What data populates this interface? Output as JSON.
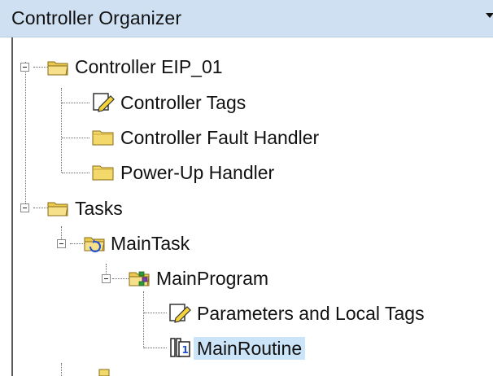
{
  "panel": {
    "title": "Controller Organizer"
  },
  "tree": {
    "controller": {
      "label": "Controller EIP_01",
      "icon": "folder-open-icon"
    },
    "controller_tags": {
      "label": "Controller Tags",
      "icon": "tags-pencil-icon"
    },
    "fault_handler": {
      "label": "Controller Fault Handler",
      "icon": "folder-icon"
    },
    "powerup_handler": {
      "label": "Power-Up Handler",
      "icon": "folder-icon"
    },
    "tasks": {
      "label": "Tasks",
      "icon": "folder-open-icon"
    },
    "main_task": {
      "label": "MainTask",
      "icon": "continuous-task-icon"
    },
    "main_program": {
      "label": "MainProgram",
      "icon": "program-folder-icon"
    },
    "params_tags": {
      "label": "Parameters and Local Tags",
      "icon": "tags-pencil-icon"
    },
    "main_routine": {
      "label": "MainRoutine",
      "icon": "main-routine-icon",
      "selected": true
    }
  },
  "colors": {
    "header_bg": "#cfe0f2",
    "selection_bg": "#cce4f7",
    "folder_yellow": "#f3d86a"
  }
}
